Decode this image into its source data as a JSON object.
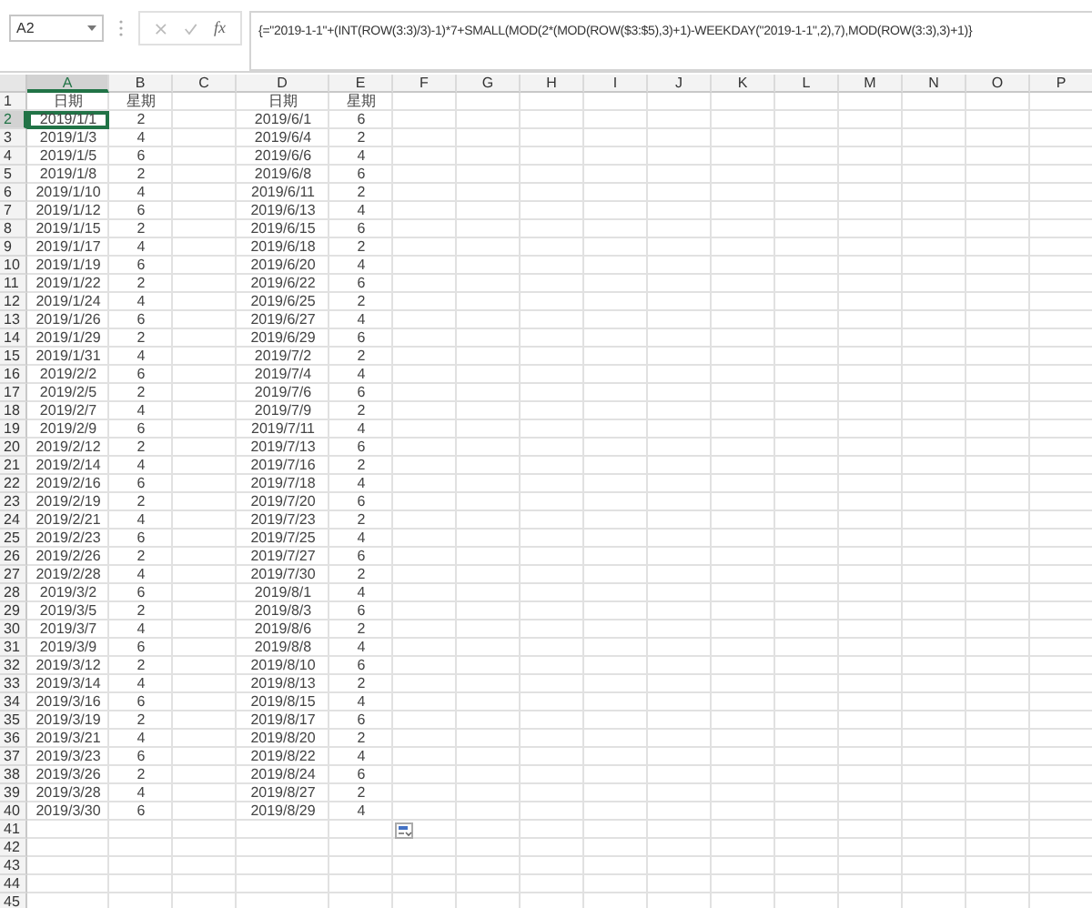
{
  "formula_bar": {
    "name_box": "A2",
    "function_label": "fx",
    "formula": "{=\"2019-1-1\"+(INT(ROW(3:3)/3)-1)*7+SMALL(MOD(2*(MOD(ROW($3:$5),3)+1)-WEEKDAY(\"2019-1-1\",2),7),MOD(ROW(3:3),3)+1)}"
  },
  "columns": [
    {
      "label": "A",
      "selected": true
    },
    {
      "label": "B",
      "selected": false
    },
    {
      "label": "C",
      "selected": false
    },
    {
      "label": "D",
      "selected": false
    },
    {
      "label": "E",
      "selected": false
    },
    {
      "label": "F",
      "selected": false
    },
    {
      "label": "G",
      "selected": false
    },
    {
      "label": "H",
      "selected": false
    },
    {
      "label": "I",
      "selected": false
    },
    {
      "label": "J",
      "selected": false
    },
    {
      "label": "K",
      "selected": false
    },
    {
      "label": "L",
      "selected": false
    },
    {
      "label": "M",
      "selected": false
    },
    {
      "label": "N",
      "selected": false
    },
    {
      "label": "O",
      "selected": false
    },
    {
      "label": "P",
      "selected": false
    }
  ],
  "rows": [
    {
      "label": "1",
      "selected": false,
      "a": "日期",
      "b": "星期",
      "d": "日期",
      "e": "星期"
    },
    {
      "label": "2",
      "selected": true,
      "a": "2019/1/1",
      "b": "2",
      "d": "2019/6/1",
      "e": "6"
    },
    {
      "label": "3",
      "selected": false,
      "a": "2019/1/3",
      "b": "4",
      "d": "2019/6/4",
      "e": "2"
    },
    {
      "label": "4",
      "selected": false,
      "a": "2019/1/5",
      "b": "6",
      "d": "2019/6/6",
      "e": "4"
    },
    {
      "label": "5",
      "selected": false,
      "a": "2019/1/8",
      "b": "2",
      "d": "2019/6/8",
      "e": "6"
    },
    {
      "label": "6",
      "selected": false,
      "a": "2019/1/10",
      "b": "4",
      "d": "2019/6/11",
      "e": "2"
    },
    {
      "label": "7",
      "selected": false,
      "a": "2019/1/12",
      "b": "6",
      "d": "2019/6/13",
      "e": "4"
    },
    {
      "label": "8",
      "selected": false,
      "a": "2019/1/15",
      "b": "2",
      "d": "2019/6/15",
      "e": "6"
    },
    {
      "label": "9",
      "selected": false,
      "a": "2019/1/17",
      "b": "4",
      "d": "2019/6/18",
      "e": "2"
    },
    {
      "label": "10",
      "selected": false,
      "a": "2019/1/19",
      "b": "6",
      "d": "2019/6/20",
      "e": "4"
    },
    {
      "label": "11",
      "selected": false,
      "a": "2019/1/22",
      "b": "2",
      "d": "2019/6/22",
      "e": "6"
    },
    {
      "label": "12",
      "selected": false,
      "a": "2019/1/24",
      "b": "4",
      "d": "2019/6/25",
      "e": "2"
    },
    {
      "label": "13",
      "selected": false,
      "a": "2019/1/26",
      "b": "6",
      "d": "2019/6/27",
      "e": "4"
    },
    {
      "label": "14",
      "selected": false,
      "a": "2019/1/29",
      "b": "2",
      "d": "2019/6/29",
      "e": "6"
    },
    {
      "label": "15",
      "selected": false,
      "a": "2019/1/31",
      "b": "4",
      "d": "2019/7/2",
      "e": "2"
    },
    {
      "label": "16",
      "selected": false,
      "a": "2019/2/2",
      "b": "6",
      "d": "2019/7/4",
      "e": "4"
    },
    {
      "label": "17",
      "selected": false,
      "a": "2019/2/5",
      "b": "2",
      "d": "2019/7/6",
      "e": "6"
    },
    {
      "label": "18",
      "selected": false,
      "a": "2019/2/7",
      "b": "4",
      "d": "2019/7/9",
      "e": "2"
    },
    {
      "label": "19",
      "selected": false,
      "a": "2019/2/9",
      "b": "6",
      "d": "2019/7/11",
      "e": "4"
    },
    {
      "label": "20",
      "selected": false,
      "a": "2019/2/12",
      "b": "2",
      "d": "2019/7/13",
      "e": "6"
    },
    {
      "label": "21",
      "selected": false,
      "a": "2019/2/14",
      "b": "4",
      "d": "2019/7/16",
      "e": "2"
    },
    {
      "label": "22",
      "selected": false,
      "a": "2019/2/16",
      "b": "6",
      "d": "2019/7/18",
      "e": "4"
    },
    {
      "label": "23",
      "selected": false,
      "a": "2019/2/19",
      "b": "2",
      "d": "2019/7/20",
      "e": "6"
    },
    {
      "label": "24",
      "selected": false,
      "a": "2019/2/21",
      "b": "4",
      "d": "2019/7/23",
      "e": "2"
    },
    {
      "label": "25",
      "selected": false,
      "a": "2019/2/23",
      "b": "6",
      "d": "2019/7/25",
      "e": "4"
    },
    {
      "label": "26",
      "selected": false,
      "a": "2019/2/26",
      "b": "2",
      "d": "2019/7/27",
      "e": "6"
    },
    {
      "label": "27",
      "selected": false,
      "a": "2019/2/28",
      "b": "4",
      "d": "2019/7/30",
      "e": "2"
    },
    {
      "label": "28",
      "selected": false,
      "a": "2019/3/2",
      "b": "6",
      "d": "2019/8/1",
      "e": "4"
    },
    {
      "label": "29",
      "selected": false,
      "a": "2019/3/5",
      "b": "2",
      "d": "2019/8/3",
      "e": "6"
    },
    {
      "label": "30",
      "selected": false,
      "a": "2019/3/7",
      "b": "4",
      "d": "2019/8/6",
      "e": "2"
    },
    {
      "label": "31",
      "selected": false,
      "a": "2019/3/9",
      "b": "6",
      "d": "2019/8/8",
      "e": "4"
    },
    {
      "label": "32",
      "selected": false,
      "a": "2019/3/12",
      "b": "2",
      "d": "2019/8/10",
      "e": "6"
    },
    {
      "label": "33",
      "selected": false,
      "a": "2019/3/14",
      "b": "4",
      "d": "2019/8/13",
      "e": "2"
    },
    {
      "label": "34",
      "selected": false,
      "a": "2019/3/16",
      "b": "6",
      "d": "2019/8/15",
      "e": "4"
    },
    {
      "label": "35",
      "selected": false,
      "a": "2019/3/19",
      "b": "2",
      "d": "2019/8/17",
      "e": "6"
    },
    {
      "label": "36",
      "selected": false,
      "a": "2019/3/21",
      "b": "4",
      "d": "2019/8/20",
      "e": "2"
    },
    {
      "label": "37",
      "selected": false,
      "a": "2019/3/23",
      "b": "6",
      "d": "2019/8/22",
      "e": "4"
    },
    {
      "label": "38",
      "selected": false,
      "a": "2019/3/26",
      "b": "2",
      "d": "2019/8/24",
      "e": "6"
    },
    {
      "label": "39",
      "selected": false,
      "a": "2019/3/28",
      "b": "4",
      "d": "2019/8/27",
      "e": "2"
    },
    {
      "label": "40",
      "selected": false,
      "a": "2019/3/30",
      "b": "6",
      "d": "2019/8/29",
      "e": "4"
    },
    {
      "label": "41",
      "selected": false,
      "paste_options": true
    },
    {
      "label": "42",
      "selected": false
    },
    {
      "label": "43",
      "selected": false
    },
    {
      "label": "44",
      "selected": false
    },
    {
      "label": "45",
      "selected": false
    }
  ]
}
